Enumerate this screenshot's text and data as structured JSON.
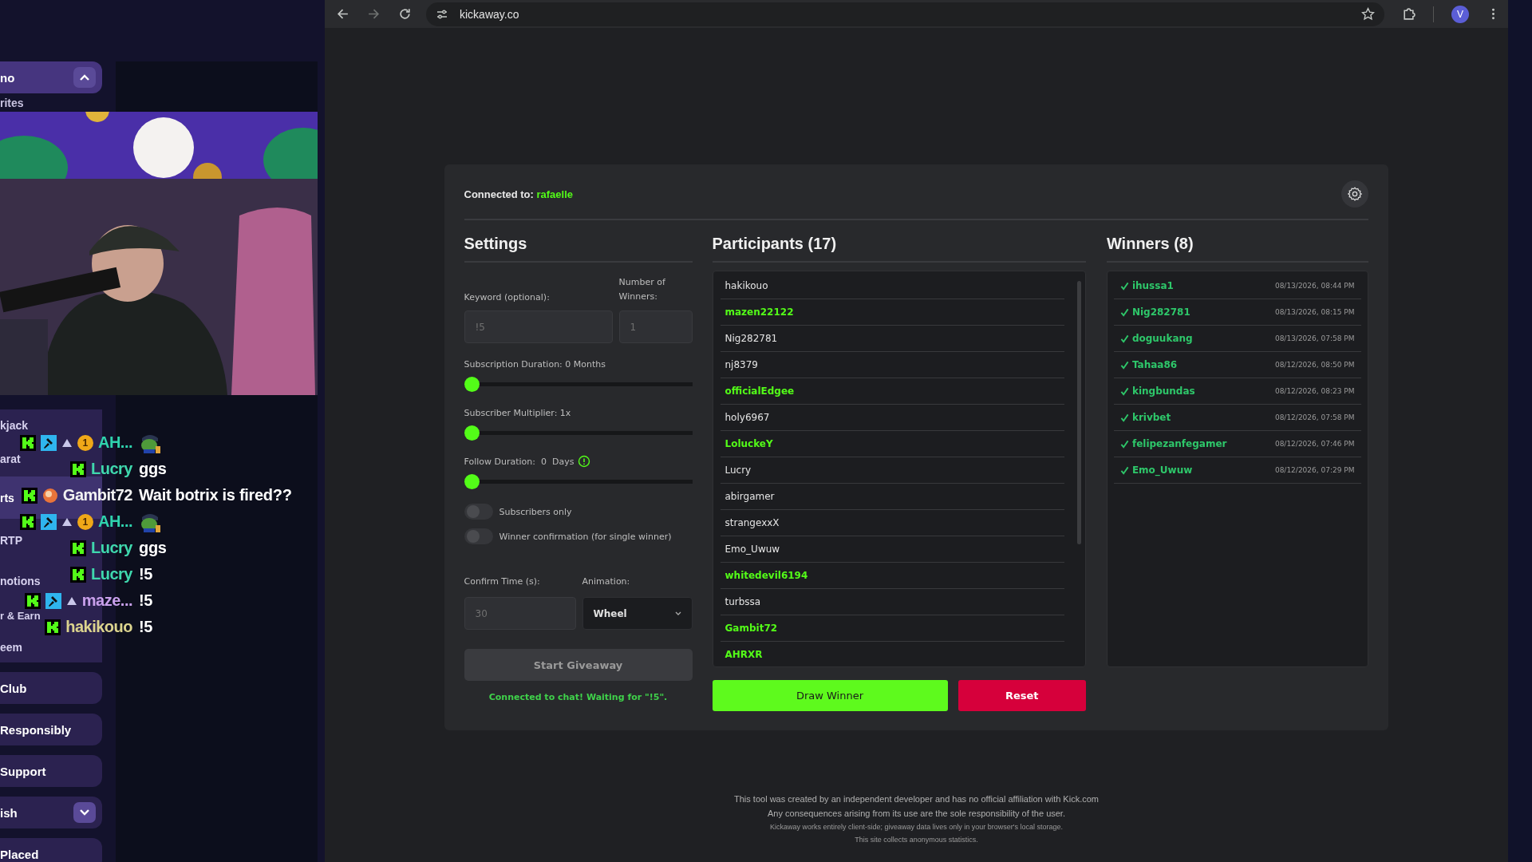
{
  "stream_site": {
    "sidebar": {
      "top_items": [
        {
          "label": "no",
          "kind": "expand-up"
        },
        {
          "label": "rites",
          "kind": "plain"
        }
      ],
      "items": [
        {
          "label": "kjack",
          "kind": "group"
        },
        {
          "label": "arat",
          "kind": "group"
        },
        {
          "label": "rts",
          "kind": "group-active"
        },
        {
          "label": "RTP",
          "kind": "group"
        },
        {
          "label": "notions",
          "kind": "group"
        },
        {
          "label": "r & Earn",
          "kind": "group"
        },
        {
          "label": "eem",
          "kind": "group"
        },
        {
          "label": "Club",
          "kind": "pill"
        },
        {
          "label": "Responsibly",
          "kind": "pill"
        },
        {
          "label": "Support",
          "kind": "pill"
        },
        {
          "label": "ish",
          "kind": "expand-down"
        },
        {
          "label": "Placed",
          "kind": "pill"
        }
      ]
    },
    "chat": [
      {
        "badges": [
          {
            "kind": "kick"
          },
          {
            "kind": "mod"
          },
          {
            "kind": "triangle"
          },
          {
            "kind": "count",
            "text": "1"
          }
        ],
        "username": "AH...",
        "color": "#2fd3ae",
        "message": {
          "kind": "emote"
        }
      },
      {
        "badges": [
          {
            "kind": "kick"
          }
        ],
        "username": "Lucry",
        "color": "#3fd8ad",
        "message": {
          "kind": "text",
          "text": "ggs"
        }
      },
      {
        "badges": [
          {
            "kind": "kick"
          },
          {
            "kind": "orb"
          }
        ],
        "username": "Gambit72",
        "color": "#f2f2f2",
        "message": {
          "kind": "text",
          "text": "Wait botrix is fired??"
        }
      },
      {
        "badges": [
          {
            "kind": "kick"
          },
          {
            "kind": "mod"
          },
          {
            "kind": "triangle"
          },
          {
            "kind": "count",
            "text": "1"
          }
        ],
        "username": "AH...",
        "color": "#2fd3ae",
        "message": {
          "kind": "emote"
        }
      },
      {
        "badges": [
          {
            "kind": "kick"
          }
        ],
        "username": "Lucry",
        "color": "#3fd8ad",
        "message": {
          "kind": "text",
          "text": "ggs"
        }
      },
      {
        "badges": [
          {
            "kind": "kick"
          }
        ],
        "username": "Lucry",
        "color": "#3fd8ad",
        "message": {
          "kind": "text",
          "text": "!5"
        }
      },
      {
        "badges": [
          {
            "kind": "kick"
          },
          {
            "kind": "mod"
          },
          {
            "kind": "triangle"
          }
        ],
        "username": "maze...",
        "color": "#c9a0ec",
        "message": {
          "kind": "text",
          "text": "!5"
        }
      },
      {
        "badges": [
          {
            "kind": "kick"
          }
        ],
        "username": "hakikouo",
        "color": "#dcd48e",
        "message": {
          "kind": "text",
          "text": "!5"
        }
      }
    ]
  },
  "browser": {
    "url": "kickaway.co",
    "profile_initial": "V"
  },
  "app": {
    "connected_label": "Connected to:",
    "channel": "rafaelle",
    "settings": {
      "title": "Settings",
      "keyword": {
        "label": "Keyword (optional):",
        "value": "!5",
        "disabled": true
      },
      "winner_count": {
        "label": "Number of Winners:",
        "value": "1",
        "disabled": true
      },
      "sliders": [
        {
          "label": "Subscription Duration: 0 Months",
          "level": 0,
          "info": false
        },
        {
          "label": "Subscriber Multiplier: 1x",
          "level": 0,
          "info": false
        },
        {
          "label": "Follow Duration:  0  Days",
          "level": 0,
          "info": true
        }
      ],
      "toggles": [
        {
          "label": "Subscribers only",
          "on": false
        },
        {
          "label": "Winner confirmation (for single winner)",
          "on": false
        }
      ],
      "confirm_time": {
        "label": "Confirm Time (s):",
        "value": "30",
        "disabled": true
      },
      "animation": {
        "label": "Animation:",
        "value": "Wheel"
      },
      "start_button": {
        "label": "Start Giveaway",
        "disabled": true
      },
      "status": "Connected to chat! Waiting for \"!5\"."
    },
    "participants": {
      "title": "Participants (17)",
      "items": [
        {
          "name": "hakikouo",
          "highlighted": false
        },
        {
          "name": "mazen22122",
          "highlighted": true
        },
        {
          "name": "Nig282781",
          "highlighted": false
        },
        {
          "name": "nj8379",
          "highlighted": false
        },
        {
          "name": "officialEdgee",
          "highlighted": true
        },
        {
          "name": "holy6967",
          "highlighted": false
        },
        {
          "name": "LoluckeY",
          "highlighted": true
        },
        {
          "name": "Lucry",
          "highlighted": false
        },
        {
          "name": "abirgamer",
          "highlighted": false
        },
        {
          "name": "strangexxX",
          "highlighted": false
        },
        {
          "name": "Emo_Uwuw",
          "highlighted": false
        },
        {
          "name": "whitedevil6194",
          "highlighted": true
        },
        {
          "name": "turbssa",
          "highlighted": false
        },
        {
          "name": "Gambit72",
          "highlighted": true
        },
        {
          "name": "AHRXR",
          "highlighted": true
        }
      ],
      "draw_button": "Draw Winner",
      "reset_button": "Reset"
    },
    "winners": {
      "title": "Winners (8)",
      "items": [
        {
          "name": "ihussa1",
          "time": "08/13/2026, 08:44 PM"
        },
        {
          "name": "Nig282781",
          "time": "08/13/2026, 08:15 PM"
        },
        {
          "name": "doguukang",
          "time": "08/13/2026, 07:58 PM"
        },
        {
          "name": "Tahaa86",
          "time": "08/12/2026, 08:50 PM"
        },
        {
          "name": "kingbundas",
          "time": "08/12/2026, 08:23 PM"
        },
        {
          "name": "krivbet",
          "time": "08/12/2026, 07:58 PM"
        },
        {
          "name": "felipezanfegamer",
          "time": "08/12/2026, 07:46 PM"
        },
        {
          "name": "Emo_Uwuw",
          "time": "08/12/2026, 07:29 PM"
        }
      ]
    },
    "footer": [
      "This tool was created by an independent developer and has no official affiliation with Kick.com",
      "Any consequences arising from its use are the sole responsibility of the user.",
      "Kickaway works entirely client-side; giveaway data lives only in your browser's local storage.",
      "This site collects anonymous statistics."
    ]
  }
}
